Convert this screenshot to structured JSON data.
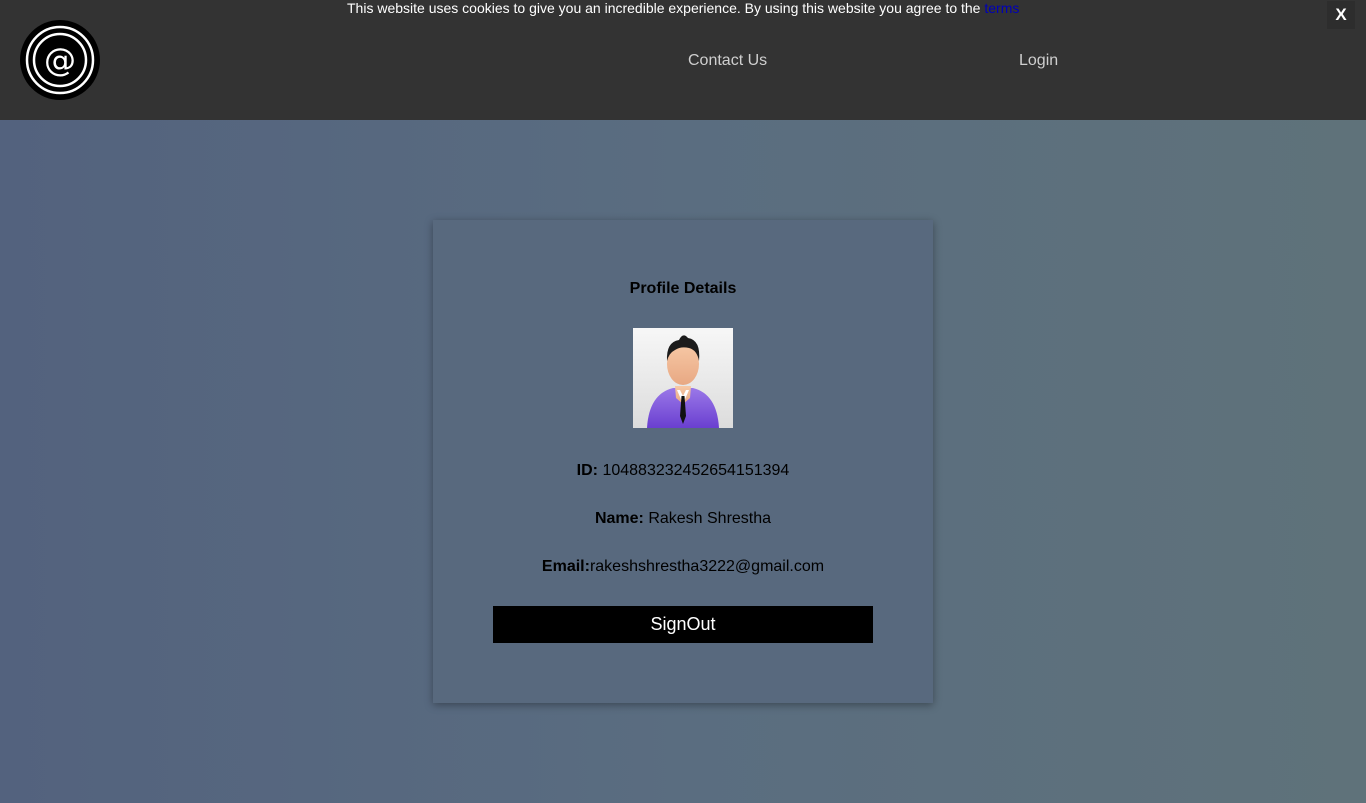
{
  "cookie_banner": {
    "message": "This website uses cookies to give you an incredible experience. By using this website you agree to the ",
    "link_text": "terms",
    "close_label": "X"
  },
  "header": {
    "logo_icon": "at-sign-logo-icon",
    "nav": {
      "contact_label": "Contact Us",
      "login_label": "Login"
    }
  },
  "profile": {
    "title": "Profile Details",
    "avatar_icon": "user-avatar-icon",
    "id_label": "ID:",
    "id_value": "104883232452654151394",
    "name_label": "Name:",
    "name_value": "Rakesh Shrestha",
    "email_label": "Email:",
    "email_value": "rakeshshrestha3222@gmail.com",
    "signout_label": "SignOut"
  },
  "colors": {
    "topbar": "#333333",
    "card": "#58697e",
    "button": "#000000",
    "link": "#0000b8"
  }
}
